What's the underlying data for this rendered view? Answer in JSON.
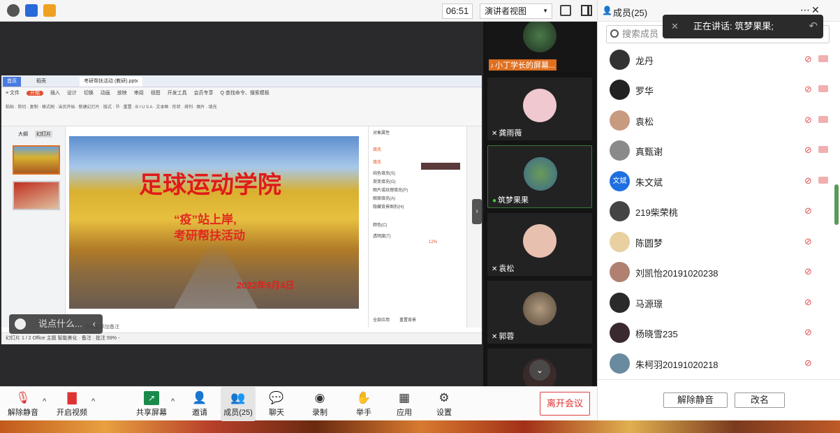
{
  "topbar": {
    "clock": "06:51",
    "presenter_view": "演讲者视图"
  },
  "ppt": {
    "tabs": [
      "首页",
      "稻壳",
      "考研帮扶活动 (教研).pptx"
    ],
    "menu": [
      "≡ 文件",
      "开始",
      "插入",
      "设计",
      "切换",
      "动画",
      "放映",
      "审阅",
      "视图",
      "开发工具",
      "会员专享",
      "Q 查找命令、搜索模板"
    ],
    "ribbon_text": "粘贴 · 剪切 · 复制 · 格式刷 · 当页开始 · 新建幻灯片 · 版式 · 节 · 重置 · B I U S A · 文本框 · 形状 · 排列 · 图片 · 填充",
    "side_tabs": [
      "大纲",
      "幻灯片"
    ],
    "slide": {
      "title": "足球运动学院",
      "sub1": "“疫”站上岸,",
      "sub2": "考研帮扶活动",
      "date": "2022年9月4日"
    },
    "props": {
      "header": "对象属性",
      "fill_tab": "填充",
      "fill_label": "填充",
      "options": [
        "纯色填充(S)",
        "渐变填充(G)",
        "图片或纹理填充(P)",
        "图案填充(A)",
        "隐藏背景图形(H)"
      ],
      "color_label": "颜色(C)",
      "transparency_label": "透明度(T)",
      "transparency_value": "12%",
      "apply_all": "全部应用",
      "reset_bg": "重置背景"
    },
    "status": "幻灯片 1 / 2     Office 主题                                                            智能美化 · 备注 · 批注          59% -",
    "notes_hint": "击此处添加备注"
  },
  "chat_bubble": {
    "placeholder": "说点什么..."
  },
  "video_tiles": [
    {
      "name": "小丁学长的屏幕..."
    },
    {
      "name": "龚雨薇"
    },
    {
      "name": "筑梦果果"
    },
    {
      "name": "袁松"
    },
    {
      "name": "郭蓉"
    }
  ],
  "toolbar": {
    "unmute": "解除静音",
    "video": "开启视频",
    "share": "共享屏幕",
    "invite": "邀请",
    "members": "成员(25)",
    "chat": "聊天",
    "record": "录制",
    "raise_hand": "举手",
    "apps": "应用",
    "settings": "设置",
    "leave": "离开会议"
  },
  "panel": {
    "title": "成员(25)",
    "search_placeholder": "搜索成员",
    "speaking": "正在讲话: 筑梦果果;",
    "members": [
      {
        "name": "龙丹",
        "color": "#333333"
      },
      {
        "name": "罗华",
        "color": "#222222"
      },
      {
        "name": "袁松",
        "color": "#c89a80"
      },
      {
        "name": "真甄谢",
        "color": "#8a8a8a"
      },
      {
        "name": "朱文斌",
        "avatar_text": "文斌",
        "color": "#1e6fe0"
      },
      {
        "name": "219柴荣桃",
        "color": "#444444"
      },
      {
        "name": "陈圆梦",
        "color": "#e8d0a0"
      },
      {
        "name": "刘凯怡20191020238",
        "color": "#b08070"
      },
      {
        "name": "马源璟",
        "color": "#2a2a2a"
      },
      {
        "name": "杨晓雪235",
        "color": "#3a2a30"
      },
      {
        "name": "朱柯羽20191020218",
        "color": "#6a8aa0"
      }
    ],
    "unmute_all": "解除静音",
    "rename": "改名"
  }
}
